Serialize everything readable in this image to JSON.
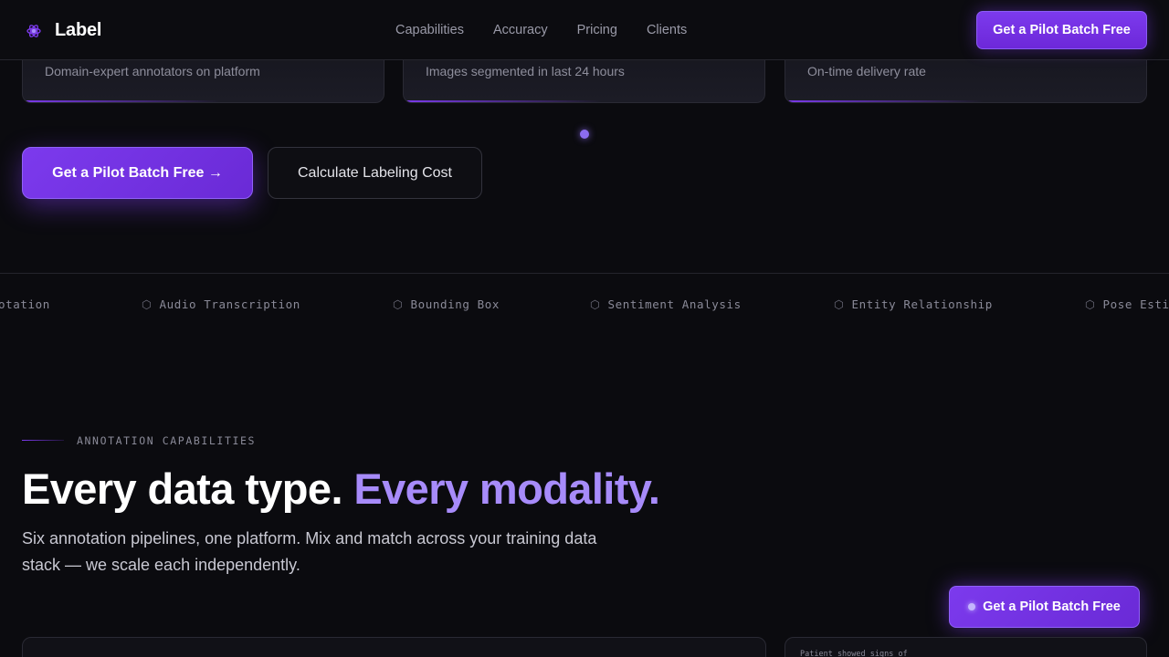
{
  "brand": {
    "name": "Label",
    "icon": "atom-logo-icon",
    "accent": "#7c3aed",
    "accent_light": "#a78bfa"
  },
  "nav": {
    "links": [
      "Capabilities",
      "Accuracy",
      "Pricing",
      "Clients"
    ],
    "cta": "Get a Pilot Batch Free"
  },
  "stats": [
    {
      "label": "Domain-expert annotators on platform"
    },
    {
      "label": "Images segmented in last 24 hours"
    },
    {
      "label": "On-time delivery rate"
    }
  ],
  "hero": {
    "primary_cta": "Get a Pilot Batch Free →",
    "secondary_cta": "Calculate Labeling Cost"
  },
  "marquee": {
    "icon": "hexagon-icon",
    "items": [
      "otation",
      "Audio Transcription",
      "Bounding Box",
      "Sentiment Analysis",
      "Entity Relationship",
      "Pose Esti"
    ]
  },
  "section": {
    "eyebrow": "ANNOTATION CAPABILITIES",
    "headline_main": "Every data type. ",
    "headline_accent": "Every modality.",
    "subhead": "Six annotation pipelines, one platform. Mix and match across your training data stack — we scale each independently."
  },
  "floating_cta": {
    "label": "Get a Pilot Batch Free"
  },
  "preview": {
    "snippet": "Patient showed signs of"
  }
}
